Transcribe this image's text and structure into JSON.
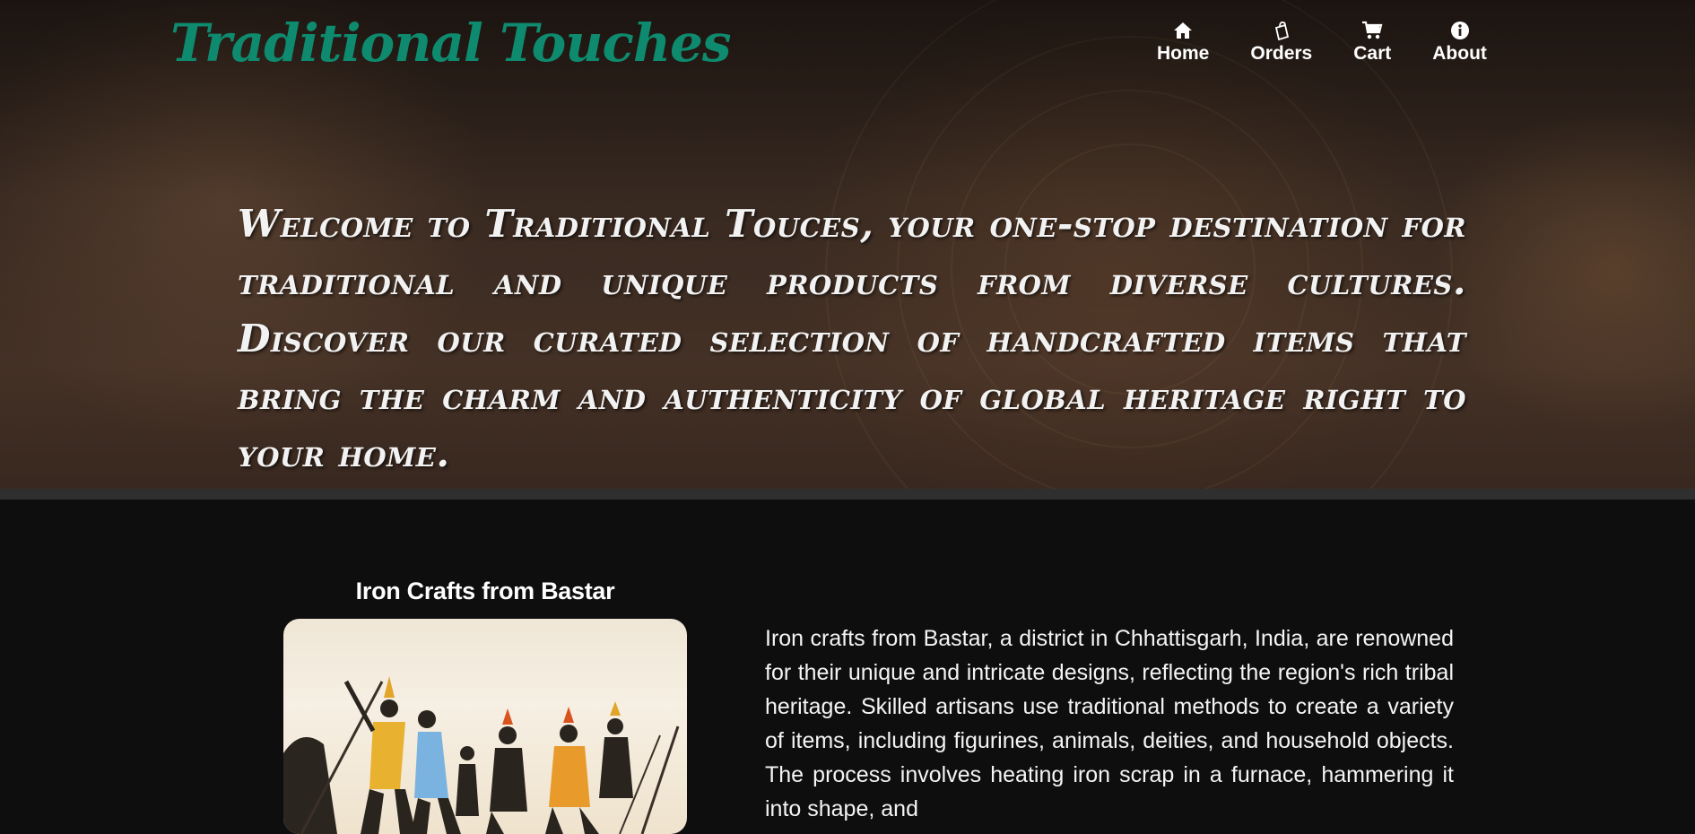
{
  "brand": {
    "name": "Traditional Touches"
  },
  "nav": {
    "items": [
      {
        "label": "Home",
        "icon": "home-icon"
      },
      {
        "label": "Orders",
        "icon": "shopping-bag-icon"
      },
      {
        "label": "Cart",
        "icon": "cart-icon"
      },
      {
        "label": "About",
        "icon": "info-icon"
      }
    ]
  },
  "hero": {
    "welcome_text": "Welcome to Traditional Touces, your one-stop destination for traditional and unique products from diverse cultures. Discover our curated selection of handcrafted items that bring the charm and authenticity of global heritage right to your home."
  },
  "feature": {
    "title": "Iron Crafts from Bastar",
    "image_alt": "iron-craft-figurines-image",
    "description": "Iron crafts from Bastar, a district in Chhattisgarh, India, are renowned for their unique and intricate designs, reflecting the region's rich tribal heritage. Skilled artisans use traditional methods to create a variety of items, including figurines, animals, deities, and household objects. The process involves heating iron scrap in a furnace, hammering it into shape, and"
  },
  "colors": {
    "brand": "#0e8a6e",
    "page_background": "#0e0e0e",
    "hero_text": "#f2f2f2",
    "divider": "#2f2f2f"
  }
}
